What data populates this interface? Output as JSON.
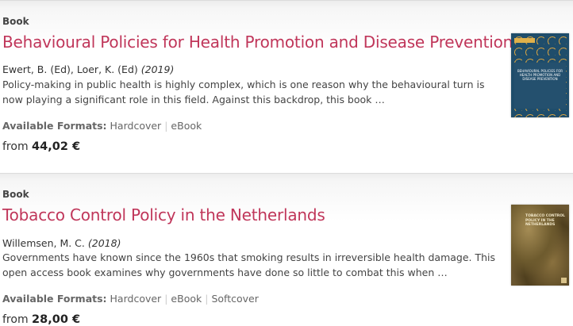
{
  "results": [
    {
      "type": "Book",
      "title": "Behavioural Policies for Health Promotion and Disease Prevention",
      "authors": "Ewert, B. (Ed), Loer, K. (Ed)",
      "year": "(2019)",
      "description": "Policy-making in public health is highly complex, which is one reason why the behavioural turn is now playing a significant role in this field. Against this backdrop, this book …",
      "formats_label": "Available Formats:",
      "formats": [
        "Hardcover",
        "eBook"
      ],
      "price_prefix": "from",
      "price": "44,02 €",
      "cover_text": "BEHAVIOURAL POLICIES FOR HEALTH PROMOTION AND DISEASE PREVENTION"
    },
    {
      "type": "Book",
      "title": "Tobacco Control Policy in the Netherlands",
      "authors": "Willemsen, M. C.",
      "year": "(2018)",
      "description": "Governments have known since the 1960s that smoking results in irreversible health damage. This open access book examines why governments have done so little to combat this when …",
      "formats_label": "Available Formats:",
      "formats": [
        "Hardcover",
        "eBook",
        "Softcover"
      ],
      "price_prefix": "from",
      "price": "28,00 €",
      "cover_text": "TOBACCO CONTROL POLICY IN THE NETHERLANDS"
    }
  ]
}
